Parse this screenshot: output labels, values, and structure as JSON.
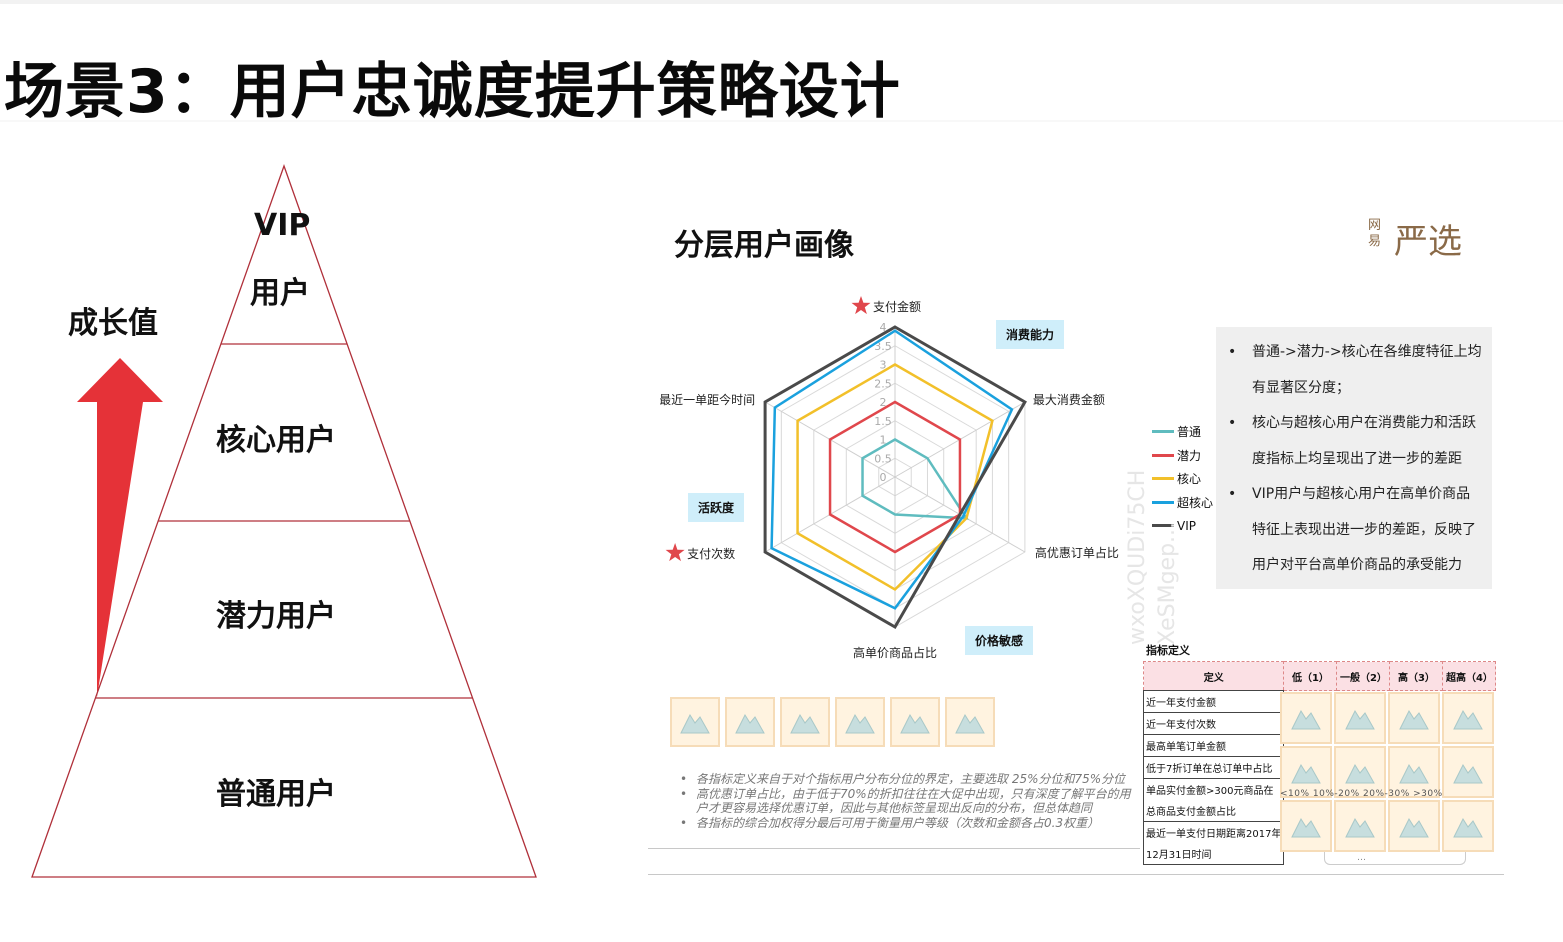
{
  "page": {
    "title": "场景3：用户忠诚度提升策略设计"
  },
  "pyramid": {
    "growth_label": "成长值",
    "tiers": [
      {
        "line1": "VIP",
        "line2": "用户"
      },
      {
        "line1": "核心用户"
      },
      {
        "line1": "潜力用户"
      },
      {
        "line1": "普通用户"
      }
    ],
    "colors": {
      "arrow": "#e53238",
      "outline": "#b0303a"
    }
  },
  "panel": {
    "title": "分层用户画像",
    "brand": {
      "small": "网易",
      "big": "严选"
    },
    "watermark": [
      "wxoXQUDi75CH",
      "XeSMgep..."
    ],
    "categories": [
      "消费能力",
      "活跃度",
      "价格敏感"
    ],
    "notes": [
      "普通->潜力->核心在各维度特征上均有显著区分度；",
      "核心与超核心用户在消费能力和活跃度指标上均呈现出了进一步的差距",
      "VIP用户与超核心用户在高单价商品特征上表现出进一步的差距，反映了用户对平台高单价商品的承受能力"
    ],
    "indicator_table": {
      "title": "指标定义",
      "headers": [
        "定义",
        "低（1）",
        "一般（2）",
        "高（3）",
        "超高（4）"
      ],
      "rows": [
        [
          "近一年支付金额"
        ],
        [
          "近一年支付次数"
        ],
        [
          "最高单笔订单金额"
        ],
        [
          "低于7折订单在总订单中占比"
        ],
        [
          "单品实付金额>300元商品在"
        ],
        [
          "总商品支付金额占比"
        ],
        [
          "最近一单支付日期距离2017年"
        ],
        [
          "12月31日时间"
        ]
      ],
      "scale_partial": "<10%   10%-20%  20%-30%   >30%"
    },
    "footnotes": [
      "各指标定义来自于对个指标用户分布分位的界定，主要选取 25%分位和75%分位",
      "高优惠订单占比，由于低于70%的折扣往往在大促中出现，只有深度了解平台的用户才更容易选择优惠订单，因此与其他标签呈现出反向的分布，但总体趋同",
      "各指标的综合加权得分最后可用于衡量用户等级（次数和金额各占0.3权重）"
    ],
    "small_frame_label": "…"
  },
  "chart_data": {
    "type": "radar",
    "axes": [
      "支付金额",
      "最大消费金额",
      "高优惠订单占比",
      "高单价商品占比",
      "支付次数",
      "最近一单距今时间"
    ],
    "starred_axes": [
      "支付金额",
      "支付次数"
    ],
    "ticks": [
      "0",
      "0.5",
      "1",
      "1.5",
      "2",
      "2.5",
      "3",
      "3.5",
      "4"
    ],
    "range": [
      0,
      4
    ],
    "grid": true,
    "legend_position": "right",
    "series": [
      {
        "name": "普通",
        "color": "#5fbcbf",
        "values": [
          1.0,
          1.0,
          2.2,
          1.0,
          1.0,
          1.0
        ]
      },
      {
        "name": "潜力",
        "color": "#e0474c",
        "values": [
          2.0,
          2.0,
          2.0,
          2.0,
          2.0,
          2.0
        ]
      },
      {
        "name": "核心",
        "color": "#f2c02a",
        "values": [
          3.0,
          3.0,
          2.2,
          3.0,
          3.0,
          3.0
        ]
      },
      {
        "name": "超核心",
        "color": "#1aa1de",
        "values": [
          3.9,
          3.6,
          2.1,
          3.5,
          3.8,
          3.7
        ]
      },
      {
        "name": "VIP",
        "color": "#4a4a4a",
        "values": [
          4.0,
          4.0,
          2.0,
          4.0,
          4.0,
          4.0
        ]
      }
    ]
  }
}
